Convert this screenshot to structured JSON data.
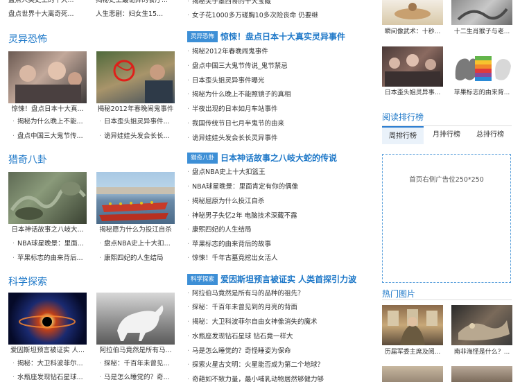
{
  "left": {
    "top_items": [
      "盘点人类史上的十大...",
      "揭秘史上最诡异的餐厅...",
      "盘点世界十大离奇死...",
      "人生悲剧：妇女生15..."
    ],
    "sections": [
      {
        "title": "灵异恐怖",
        "captions": [
          "惊悚！盘点日本十大真...",
          "揭秘2012年春晚闹鬼事件"
        ],
        "items": [
          "揭秘为什么晚上不能...",
          "日本歪头姐灵异事件...",
          "盘点中国三大鬼节传...",
          "诡异娃娃头发会长长..."
        ]
      },
      {
        "title": "猎奇八卦",
        "captions": [
          "日本神话故事之八岐大...",
          "揭秘愿为什么为投江自杀"
        ],
        "items": [
          "NBA球星晚景：里面...",
          "盘点NBA史上十大扣...",
          "苹果标志的由来背后...",
          "康熙四妃的人生结局"
        ]
      },
      {
        "title": "科学探索",
        "captions": [
          "爱因斯坦预言被证实 人...",
          "阿拉伯马竟然是所有马..."
        ],
        "items": [
          "揭秘：大卫科波菲尔...",
          "探秘：千百年未曾见...",
          "水瓶座发现钻石星球...",
          "马是怎么睡觉的？奇..."
        ]
      }
    ]
  },
  "mid": {
    "top_items": [
      "揭秘关于墨西哥的十大宝藏",
      "女子花1000多万磋胸10多次险丧命 仍要继"
    ],
    "sections": [
      {
        "badge": "灵异恐怖",
        "headline": "惊悚！盘点日本十大真实灵异事件",
        "items": [
          "揭秘2012年春晚闹鬼事件",
          "盘点中国三大鬼节传说_鬼节禁忌",
          "日本歪头姐灵异事件曝光",
          "揭秘为什么晚上不能照镜子的真相",
          "半夜出现的日本如月车站事件",
          "我国传统节日七月半鬼节的由来",
          "诡异娃娃头发会长长灵异事件"
        ]
      },
      {
        "badge": "猎奇八卦",
        "headline": "日本神话故事之八岐大蛇的传说",
        "items": [
          "盘点NBA史上十大扣篮王",
          "NBA球星晚景：里面肯定有你的偶像",
          "揭秘屈原为什么投江自杀",
          "神秘男子失忆2年 电脑技术深藏不露",
          "康熙四妃的人生结局",
          "苹果标志的由来背后的故事",
          "惊悚！千年古墓竟挖出女活人"
        ]
      },
      {
        "badge": "科学探索",
        "headline": "爱因斯坦预言被证实 人类首探引力波",
        "items": [
          "阿拉伯马竟然是所有马的品种的祖先？",
          "探秘：千百年未曾见到的月亮的背面",
          "揭秘：大卫科波菲尔自由女神像消失的魔术",
          "水瓶座发现钻石星球 钻石竟一样大",
          "马是怎么睡觉的？奇怪睡姿为保命",
          "探索火星古文明：火星能否成为第二个地球？",
          "奇葩如不致力量，最小哺乳动物居然够健力够"
        ]
      }
    ]
  },
  "right": {
    "top_captions": [
      "瞬间像武术：十秒...",
      "十二生肖猴子与老..."
    ],
    "mid_captions": [
      "日本歪头姐灵异事...",
      "苹果标志的由来背..."
    ],
    "rank_title": "阅读排行榜",
    "tabs": [
      "周排行榜",
      "月排行榜",
      "总排行榜"
    ],
    "ad_text": "首页右侧广告位250*250",
    "hot_title": "热门图片",
    "hot_captions": [
      "历届军委主席及阅...",
      "南非海怪是什么？..."
    ]
  },
  "colors": {
    "accent": "#1e78c8",
    "badge": "#3d8fd6"
  }
}
